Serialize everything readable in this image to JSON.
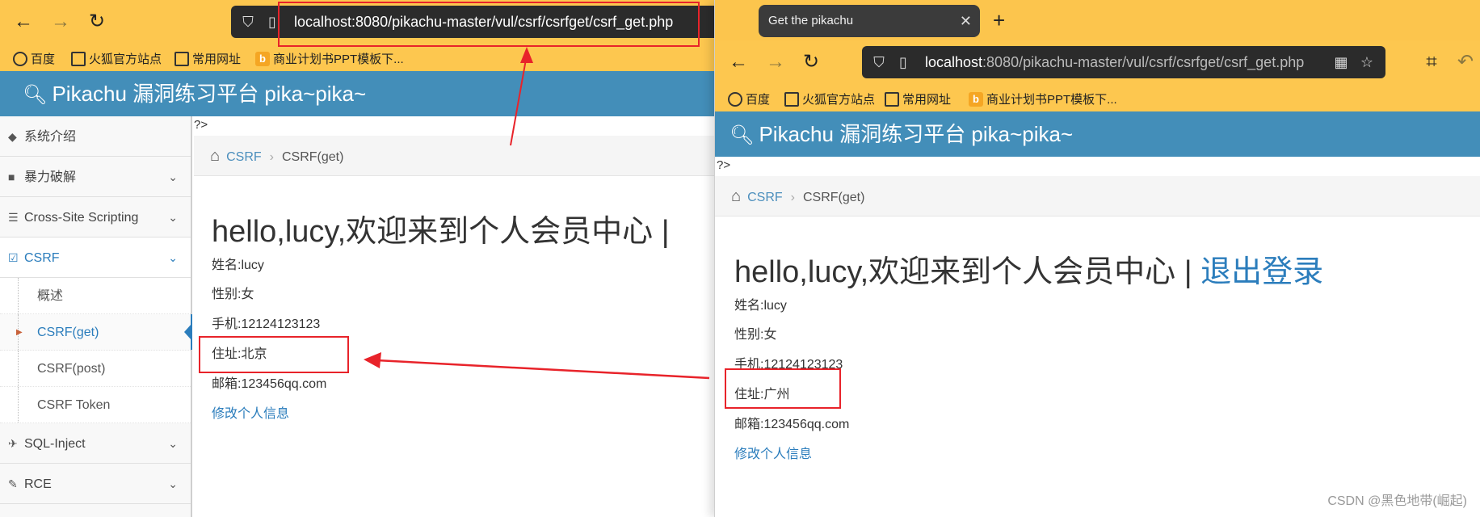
{
  "left_window": {
    "url": "localhost:8080/pikachu-master/vul/csrf/csrfget/csrf_get.php",
    "bookmarks": [
      "百度",
      "火狐官方站点",
      "常用网址",
      "商业计划书PPT模板下..."
    ],
    "site_title": "Pikachu 漏洞练习平台 pika~pika~",
    "stray_text": "?>",
    "sidebar": {
      "items": [
        {
          "label": "系统介绍",
          "icon": "tags-icon"
        },
        {
          "label": "暴力破解",
          "icon": "lock-icon"
        },
        {
          "label": "Cross-Site Scripting",
          "icon": "list-icon"
        },
        {
          "label": "CSRF",
          "icon": "edit-icon"
        }
      ],
      "sub_items": [
        "概述",
        "CSRF(get)",
        "CSRF(post)",
        "CSRF Token"
      ],
      "bottom_items": [
        {
          "label": "SQL-Inject",
          "icon": "plane-icon"
        },
        {
          "label": "RCE",
          "icon": "pencil-icon"
        }
      ]
    },
    "breadcrumb": {
      "link": "CSRF",
      "current": "CSRF(get)"
    },
    "greeting": "hello,lucy,欢迎来到个人会员中心 |",
    "fields": {
      "name": "姓名:lucy",
      "gender": "性别:女",
      "phone": "手机:12124123123",
      "address": "住址:北京",
      "email": "邮箱:123456qq.com"
    },
    "edit_link": "修改个人信息"
  },
  "right_window": {
    "tab_title": "Get the pikachu",
    "url_host": "localhost",
    "url_rest": ":8080/pikachu-master/vul/csrf/csrfget/csrf_get.php",
    "bookmarks": [
      "百度",
      "火狐官方站点",
      "常用网址",
      "商业计划书PPT模板下..."
    ],
    "site_title": "Pikachu 漏洞练习平台 pika~pika~",
    "stray_text": "?>",
    "breadcrumb": {
      "link": "CSRF",
      "current": "CSRF(get)"
    },
    "greeting": "hello,lucy,欢迎来到个人会员中心 |",
    "logout": "退出登录",
    "fields": {
      "name": "姓名:lucy",
      "gender": "性别:女",
      "phone": "手机:12124123123",
      "address": "住址:广州",
      "email": "邮箱:123456qq.com"
    },
    "edit_link": "修改个人信息"
  },
  "watermark": "CSDN @黑色地带(崛起)",
  "colors": {
    "chrome_yellow": "#fdc74f",
    "header_blue": "#438eb9",
    "link_blue": "#2b7dbc",
    "annotation_red": "#e8232a"
  }
}
